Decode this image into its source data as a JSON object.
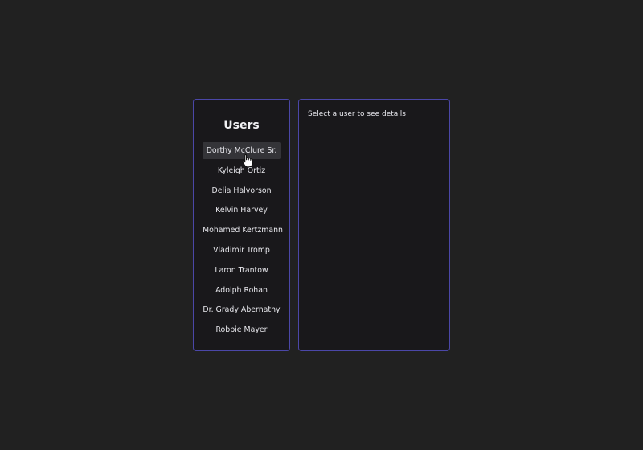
{
  "users_panel": {
    "title": "Users",
    "users": [
      "Dorthy McClure Sr.",
      "Kyleigh Ortiz",
      "Delia Halvorson",
      "Kelvin Harvey",
      "Mohamed Kertzmann",
      "Vladimir Tromp",
      "Laron Trantow",
      "Adolph Rohan",
      "Dr. Grady Abernathy",
      "Robbie Mayer"
    ],
    "hovered_user": "Dorthy McClure Sr."
  },
  "details_panel": {
    "placeholder": "Select a user to see details"
  },
  "colors": {
    "background": "#212121",
    "panel": "#19181b",
    "panel_border": "#4b47a8",
    "hover": "#343438"
  },
  "icons": {
    "cursor": "hand-pointer-icon"
  }
}
